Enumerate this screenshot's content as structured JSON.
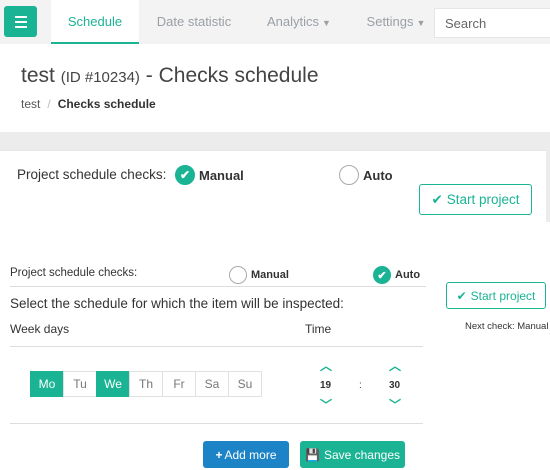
{
  "nav": {
    "tabs": [
      {
        "label": "Schedule",
        "active": true
      },
      {
        "label": "Date statistic"
      },
      {
        "label": "Analytics",
        "dropdown": true
      },
      {
        "label": "Settings",
        "dropdown": true
      }
    ],
    "search_placeholder": "Search"
  },
  "page": {
    "title_main": "test",
    "title_id": "(ID #10234)",
    "title_suffix": "- Checks schedule",
    "breadcrumb": [
      "test",
      "Checks schedule"
    ]
  },
  "panel1": {
    "label": "Project schedule checks:",
    "option_manual": "Manual",
    "option_auto": "Auto",
    "selected": "Manual",
    "start_button": "Start project"
  },
  "panel2": {
    "label": "Project schedule checks:",
    "option_manual": "Manual",
    "option_auto": "Auto",
    "selected": "Auto",
    "start_button": "Start project",
    "heading": "Select the schedule for which the item will be inspected:",
    "week_days_label": "Week days",
    "time_label": "Time",
    "next_check": "Next check: Manual",
    "days": [
      {
        "label": "Mo",
        "selected": true
      },
      {
        "label": "Tu",
        "selected": false
      },
      {
        "label": "We",
        "selected": true
      },
      {
        "label": "Th",
        "selected": false
      },
      {
        "label": "Fr",
        "selected": false
      },
      {
        "label": "Sa",
        "selected": false
      },
      {
        "label": "Su",
        "selected": false
      }
    ],
    "hour": "19",
    "time_separator": ":",
    "minute": "30",
    "add_more": "Add more",
    "save_changes": "Save changes"
  },
  "colors": {
    "accent": "#1ab394",
    "primary_blue": "#1c84c6"
  }
}
